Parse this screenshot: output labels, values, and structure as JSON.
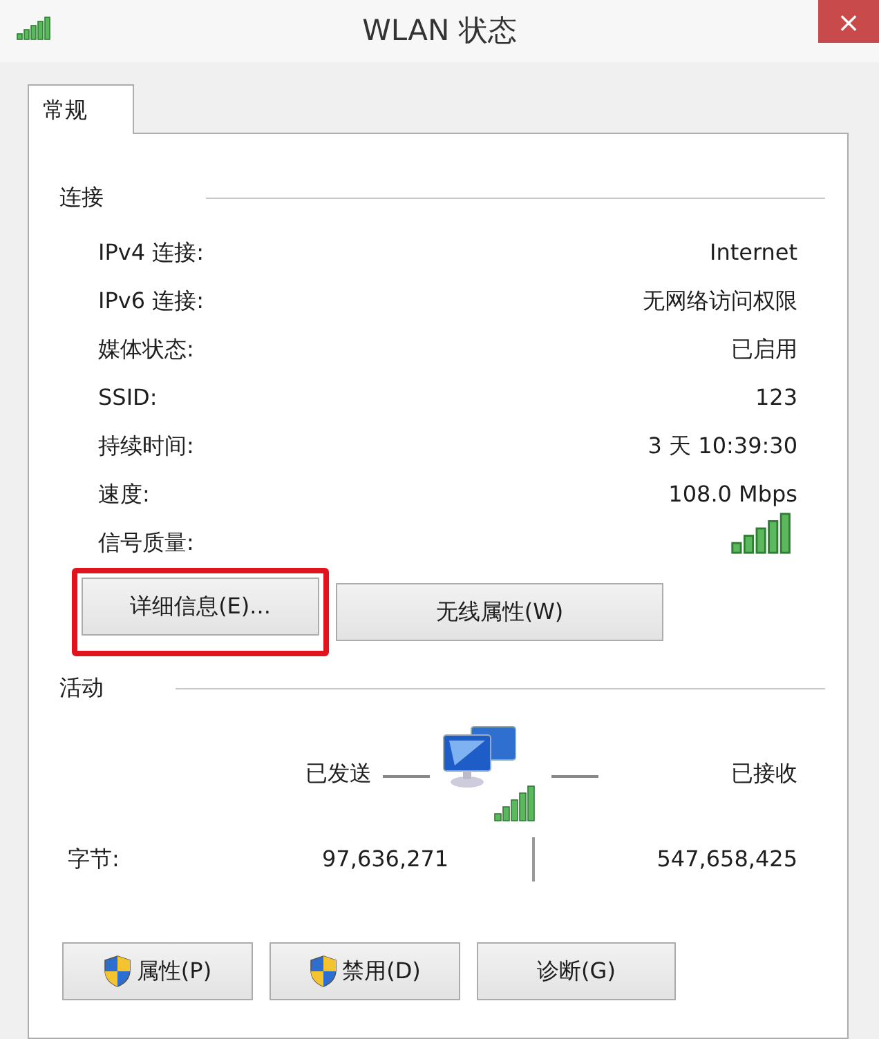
{
  "window": {
    "title": "WLAN 状态",
    "close": "×"
  },
  "tabs": [
    {
      "label": "常规",
      "selected": true
    }
  ],
  "connection": {
    "heading": "连接",
    "rows": [
      {
        "kind": "text",
        "label": "IPv4 连接:",
        "value": "Internet"
      },
      {
        "kind": "text",
        "label": "IPv6 连接:",
        "value": "无网络访问权限"
      },
      {
        "kind": "text",
        "label": "媒体状态:",
        "value": "已启用"
      },
      {
        "kind": "text",
        "label": "SSID:",
        "value": "123"
      },
      {
        "kind": "text",
        "label": "持续时间:",
        "value": "3 天 10:39:30"
      },
      {
        "kind": "text",
        "label": "速度:",
        "value": "108.0 Mbps"
      },
      {
        "kind": "signal",
        "label": "信号质量:"
      }
    ],
    "buttons": [
      {
        "label": "详细信息(E)...",
        "highlighted": true
      },
      {
        "label": "无线属性(W)",
        "highlighted": false
      }
    ]
  },
  "activity": {
    "heading": "活动",
    "sent": "已发送",
    "received": "已接收",
    "bytes_label": "字节:",
    "bytes_sent": "97,636,271",
    "bytes_received": "547,658,425"
  },
  "footer_buttons": [
    {
      "label": "属性(P)",
      "shield": true
    },
    {
      "label": "禁用(D)",
      "shield": true
    },
    {
      "label": "诊断(G)",
      "shield": false
    }
  ]
}
